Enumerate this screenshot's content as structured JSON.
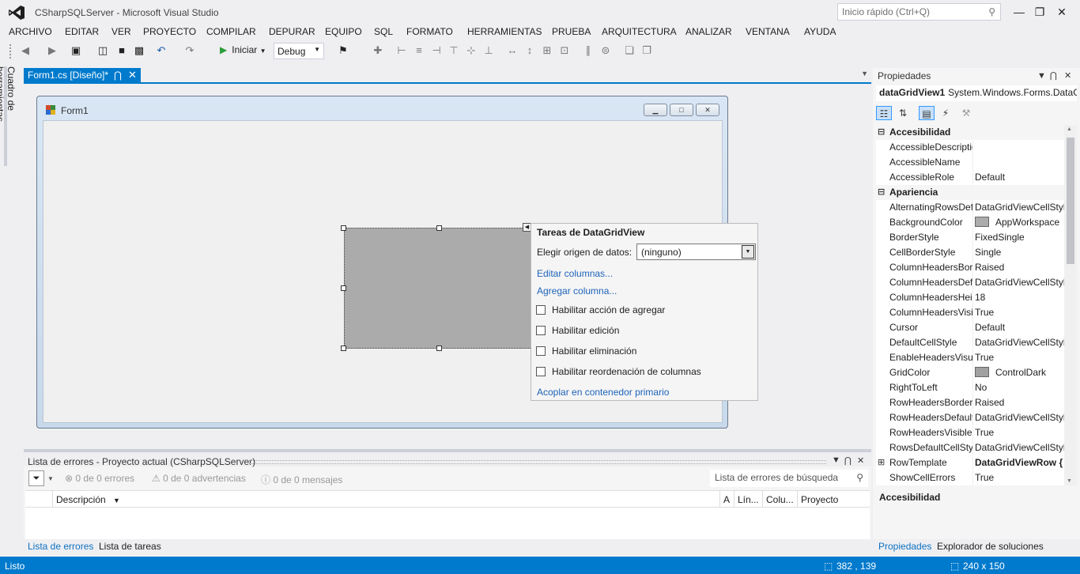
{
  "window": {
    "title": "CSharpSQLServer - Microsoft Visual Studio",
    "quick_launch_placeholder": "Inicio rápido (Ctrl+Q)"
  },
  "menu": [
    "ARCHIVO",
    "EDITAR",
    "VER",
    "PROYECTO",
    "COMPILAR",
    "DEPURAR",
    "EQUIPO",
    "SQL",
    "FORMATO",
    "HERRAMIENTAS",
    "PRUEBA",
    "ARQUITECTURA",
    "ANALIZAR",
    "VENTANA",
    "AYUDA"
  ],
  "toolbar": {
    "start_label": "Iniciar",
    "config_value": "Debug"
  },
  "toolbox": {
    "label": "Cuadro de herramientas"
  },
  "document": {
    "tab_label": "Form1.cs [Diseño]*"
  },
  "form": {
    "title": "Form1"
  },
  "smart_tag": {
    "title": "Tareas de DataGridView",
    "datasource_label": "Elegir origen de datos:",
    "datasource_value": "(ninguno)",
    "links": [
      "Editar columnas...",
      "Agregar columna..."
    ],
    "checks": [
      "Habilitar acción de agregar",
      "Habilitar edición",
      "Habilitar eliminación",
      "Habilitar reordenación de columnas"
    ],
    "dock_link": "Acoplar en contenedor primario"
  },
  "error_list": {
    "title": "Lista de errores - Proyecto actual (CSharpSQLServer)",
    "errors": "0 de 0 errores",
    "warnings": "0 de 0 advertencias",
    "messages": "0 de 0 mensajes",
    "search_placeholder": "Lista de errores de búsqueda",
    "columns": [
      "Descripción",
      "A",
      "Lín...",
      "Colu...",
      "Proyecto"
    ]
  },
  "bottom_tabs": [
    "Lista de errores",
    "Lista de tareas"
  ],
  "properties": {
    "title": "Propiedades",
    "object_name": "dataGridView1",
    "object_type": "System.Windows.Forms.DataGridView",
    "rows": [
      {
        "type": "cat",
        "name": "Accesibilidad"
      },
      {
        "name": "AccessibleDescription",
        "value": ""
      },
      {
        "name": "AccessibleName",
        "value": ""
      },
      {
        "name": "AccessibleRole",
        "value": "Default"
      },
      {
        "type": "cat",
        "name": "Apariencia"
      },
      {
        "name": "AlternatingRowsDefaultCellStyle",
        "value": "DataGridViewCellStyle"
      },
      {
        "name": "BackgroundColor",
        "value": "AppWorkspace",
        "swatch": "#ababab"
      },
      {
        "name": "BorderStyle",
        "value": "FixedSingle"
      },
      {
        "name": "CellBorderStyle",
        "value": "Single"
      },
      {
        "name": "ColumnHeadersBorderStyle",
        "value": "Raised"
      },
      {
        "name": "ColumnHeadersDefaultCellStyle",
        "value": "DataGridViewCellStyle"
      },
      {
        "name": "ColumnHeadersHeight",
        "value": "18"
      },
      {
        "name": "ColumnHeadersVisible",
        "value": "True"
      },
      {
        "name": "Cursor",
        "value": "Default"
      },
      {
        "name": "DefaultCellStyle",
        "value": "DataGridViewCellStyle"
      },
      {
        "name": "EnableHeadersVisualStyles",
        "value": "True"
      },
      {
        "name": "GridColor",
        "value": "ControlDark",
        "swatch": "#a0a0a0"
      },
      {
        "name": "RightToLeft",
        "value": "No"
      },
      {
        "name": "RowHeadersBorderStyle",
        "value": "Raised"
      },
      {
        "name": "RowHeadersDefaultCellStyle",
        "value": "DataGridViewCellStyle"
      },
      {
        "name": "RowHeadersVisible",
        "value": "True"
      },
      {
        "name": "RowsDefaultCellStyle",
        "value": "DataGridViewCellStyle"
      },
      {
        "name": "RowTemplate",
        "value": "DataGridViewRow {",
        "expandable": true,
        "bold_value": true
      },
      {
        "name": "ShowCellErrors",
        "value": "True"
      }
    ],
    "description_title": "Accesibilidad"
  },
  "props_bottom_tabs": [
    "Propiedades",
    "Explorador de soluciones"
  ],
  "status": {
    "text": "Listo",
    "position": "382 , 139",
    "size": "240 x 150"
  }
}
